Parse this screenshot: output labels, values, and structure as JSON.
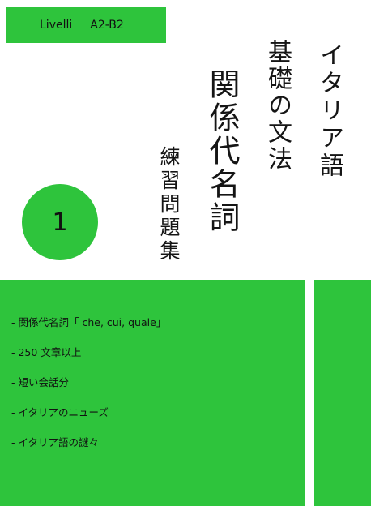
{
  "header": {
    "level_label": "Livelli",
    "level_value": "A2-B2"
  },
  "title": {
    "line1": "イタリア語",
    "line2": "基礎の文法",
    "line3": "関係代名詞",
    "line4": "練習問題集"
  },
  "volume_number": "1",
  "bullets": [
    "- 関係代名詞「 che, cui, quale」",
    "- 250 文章以上",
    "- 短い会話分",
    "- イタリアのニューズ",
    "- イタリア語の謎々"
  ],
  "colors": {
    "accent": "#2ec43c",
    "background": "#ffffff",
    "text": "#111111"
  }
}
